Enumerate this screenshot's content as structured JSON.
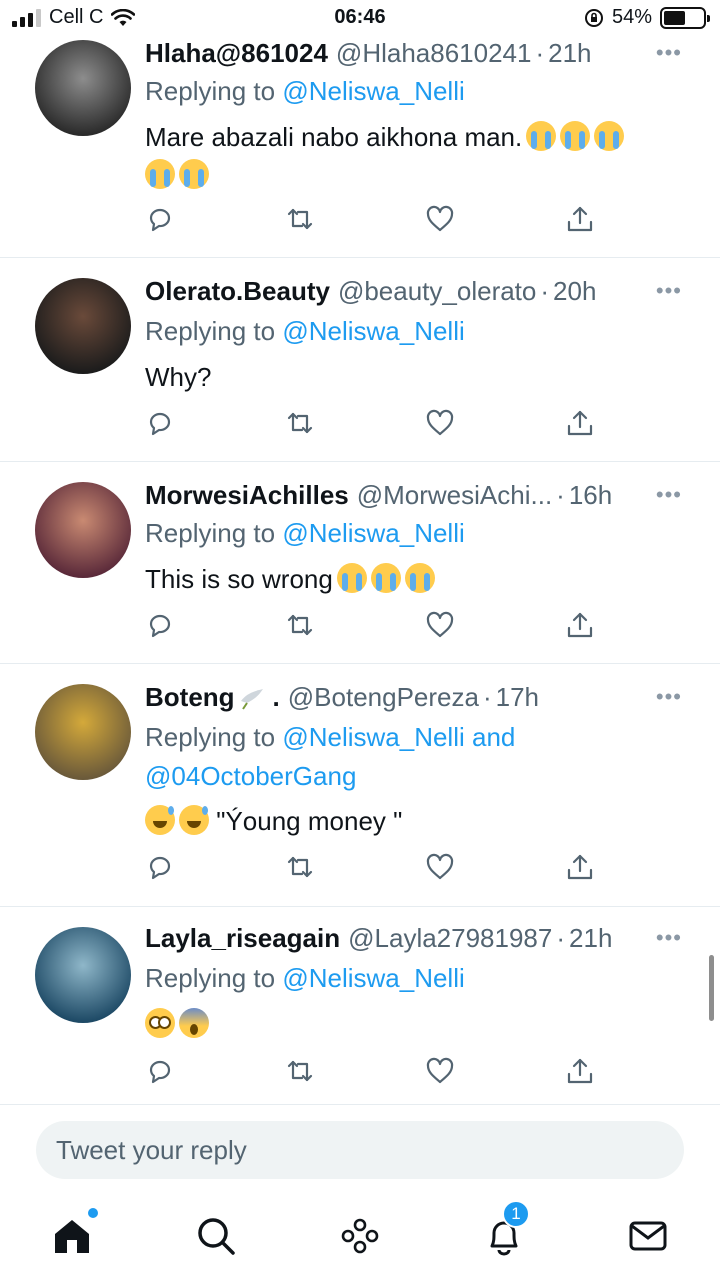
{
  "status_bar": {
    "carrier": "Cell C",
    "time": "06:46",
    "battery": "54%",
    "battery_level": 0.54
  },
  "tweets": [
    {
      "name": "Hlaha@861024",
      "handle": "@Hlaha8610241",
      "time": "21h",
      "replying_label": "Replying to",
      "mention": "@Neliswa_Nelli",
      "mention2": "",
      "text": "Mare abazali nabo aikhona man.",
      "emoji_line": "",
      "avatar_colors": [
        "#2b2b2b",
        "#8d8d8d"
      ]
    },
    {
      "name": "Olerato.Beauty",
      "handle": "@beauty_olerato",
      "time": "20h",
      "replying_label": "Replying to",
      "mention": "@Neliswa_Nelli",
      "mention2": "",
      "text": "Why?",
      "emoji_line": "",
      "avatar_colors": [
        "#1c1c1c",
        "#6a4a3a"
      ]
    },
    {
      "name": "MorwesiAchilles",
      "handle": "@MorwesiAchi...",
      "time": "16h",
      "replying_label": "Replying to",
      "mention": "@Neliswa_Nelli",
      "mention2": "",
      "text": "This is so wrong",
      "emoji_line": "",
      "avatar_colors": [
        "#5b2a3a",
        "#c98a72"
      ]
    },
    {
      "name": "Boteng",
      "name_suffix": ".",
      "handle": "@BotengPereza",
      "time": "17h",
      "replying_label": "Replying to",
      "mention": "@Neliswa_Nelli and",
      "mention2": "@04OctoberGang",
      "text": "\"Ýoung money \"",
      "emoji_line": "",
      "avatar_colors": [
        "#6b5a3a",
        "#d4a93a"
      ]
    },
    {
      "name": "Layla_riseagain",
      "handle": "@Layla27981987",
      "time": "21h",
      "replying_label": "Replying to",
      "mention": "@Neliswa_Nelli",
      "mention2": "",
      "text": "",
      "emoji_line": "",
      "avatar_colors": [
        "#1e4a66",
        "#8fb7c9"
      ]
    }
  ],
  "more_label": "•••",
  "reply_box": {
    "placeholder": "Tweet your reply"
  },
  "tab_bar": {
    "notification_count": "1"
  },
  "colors": {
    "accent": "#1d9bf0",
    "text": "#0f1419",
    "muted": "#536471",
    "divider": "#e6ecf0"
  },
  "icons": [
    "reply-icon",
    "retweet-icon",
    "like-icon",
    "share-icon",
    "home-icon",
    "search-icon",
    "spaces-icon",
    "notifications-icon",
    "messages-icon"
  ]
}
